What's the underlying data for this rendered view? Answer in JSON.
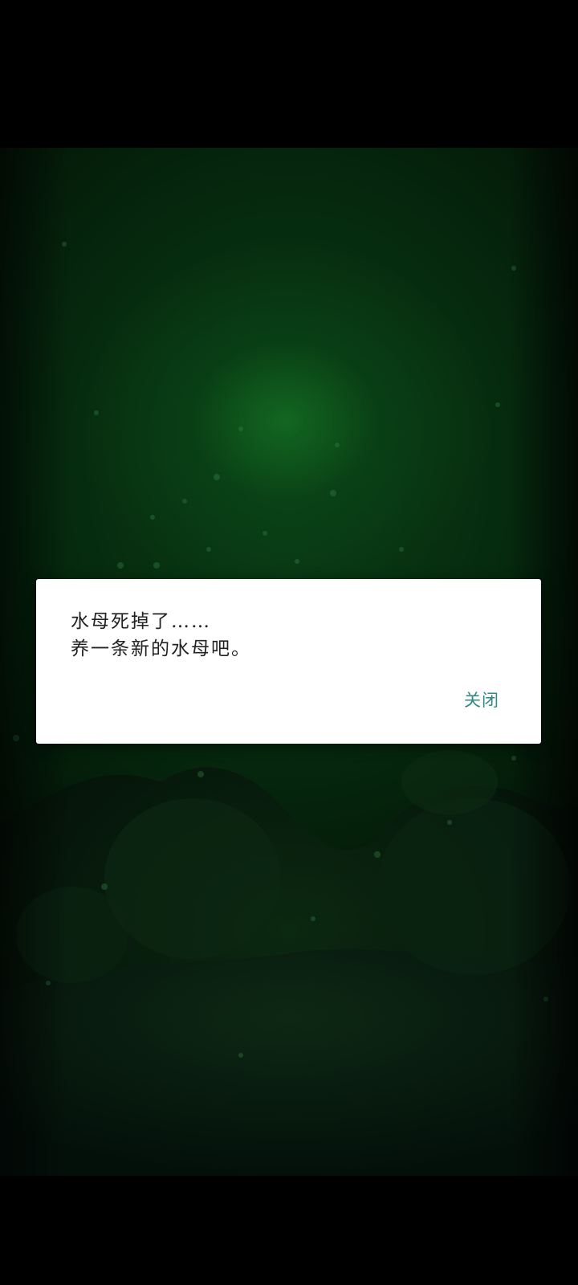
{
  "dialog": {
    "message_line1": "水母死掉了……",
    "message_line2": "养一条新的水母吧。",
    "close_label": "关闭"
  },
  "colors": {
    "background": "#000000",
    "water_glow": "#146e23",
    "water_deep": "#031507",
    "dialog_bg": "#ffffff",
    "dialog_text": "#222222",
    "button_accent": "#2e8a82"
  }
}
